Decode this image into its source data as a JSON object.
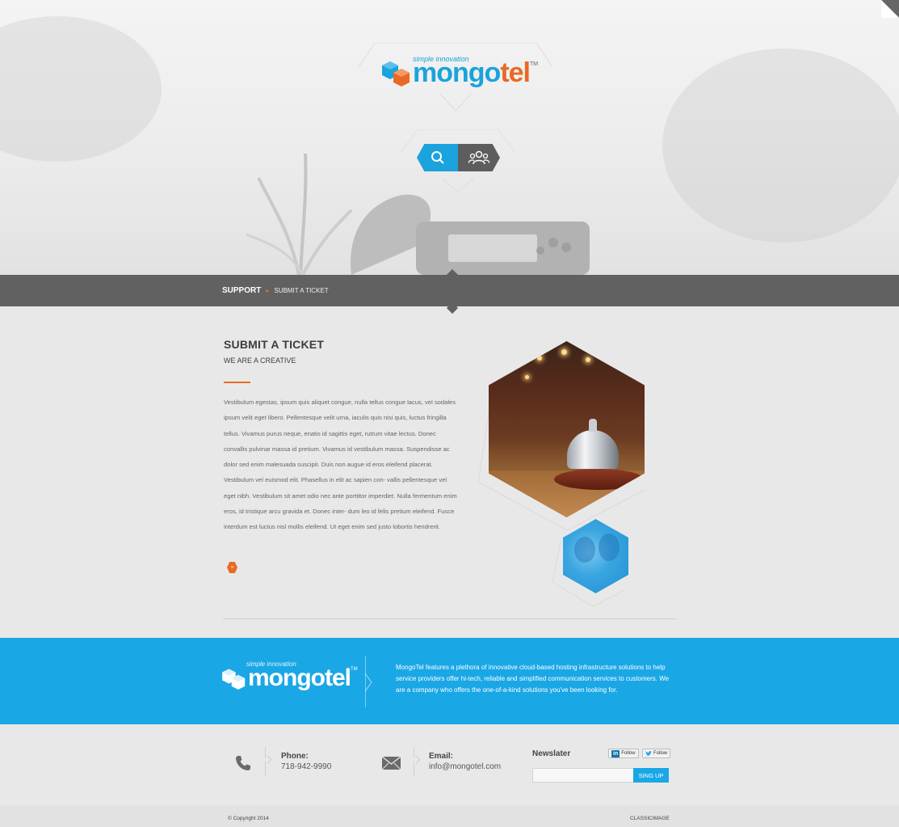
{
  "brand": {
    "tagline": "simple innovation",
    "name_part1": "mongo",
    "name_part2": "tel",
    "trademark": "TM",
    "accent_color": "#1aa7e6",
    "highlight_color": "#e86a24"
  },
  "nav": {
    "search_icon": "search-icon",
    "team_icon": "team-icon"
  },
  "breadcrumb": {
    "root": "SUPPORT",
    "separator": "▸",
    "current": "SUBMIT A TICKET"
  },
  "main": {
    "title": "SUBMIT A TICKET",
    "subtitle": "WE ARE A CREATIVE",
    "body": "Vestibulum egestas, ipsum quis aliquet congue, nulla tellus congue lacus, vel sodales ipsum velit eget libero. Pellentesque velit urna, iaculis quis nisi quis, luctus fringilla tellus. Vivamus purus neque, enatis id sagittis eget, rutrum vitae lectus. Donec convallis pulvinar massa id pretium. Vivamus id vestibulum massa. Suspendisse ac dolor sed enim malesuada suscipit. Duis non augue id eros eleifend placerat. Vestibulum vel euismod elit. Phasellus in elit ac sapien con- vallis pellentesque vel eget nibh. Vestibulum sit amet odio nec ante porttitor imperdiet. Nulla fermentum enim eros, id tristique arcu gravida et. Donec inter- dum leo id felis pretium eleifend. Fusce interdum est luctus nisl mollis eleifend. Ut eget enim sed justo lobortis hendrerit.",
    "more_glyph": "»"
  },
  "footer_band": {
    "tagline": "simple innovation",
    "name": "mongotel",
    "trademark": "TM",
    "about": "MongoTel features a plethora of innovative cloud-based hosting infrastructure solutions to help service providers offer hi-tech, reliable and simplified communication services to customers. We are a company who offers the one-of-a-kind solutions you've been looking for."
  },
  "contact": {
    "phone_label": "Phone:",
    "phone_value": "718-942-9990",
    "email_label": "Email:",
    "email_value": "info@mongotel.com"
  },
  "newsletter": {
    "label": "Newslater",
    "linkedin_badge": "in",
    "linkedin_follow": "Follow",
    "twitter_follow": "Follow",
    "input_placeholder": "",
    "button_label": "SING UP"
  },
  "bottom": {
    "copyright": "© Copyright 2014",
    "credit": "CLASSICIMAGE"
  }
}
